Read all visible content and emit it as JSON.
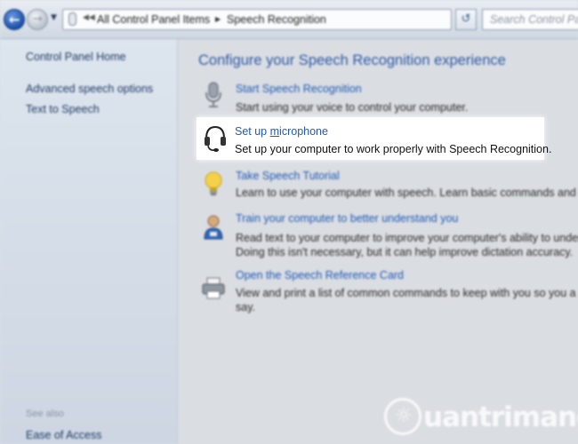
{
  "toolbar": {
    "breadcrumbs": [
      "All Control Panel Items",
      "Speech Recognition"
    ],
    "search_placeholder": "Search Control Pan"
  },
  "sidebar": {
    "home": "Control Panel Home",
    "links": [
      "Advanced speech options",
      "Text to Speech"
    ],
    "see_also_label": "See also",
    "see_also_links": [
      "Ease of Access"
    ]
  },
  "main": {
    "title": "Configure your Speech Recognition experience",
    "tasks": [
      {
        "icon": "microphone-icon",
        "link": "Start Speech Recognition",
        "desc": [
          "Start using your voice to control your computer."
        ]
      },
      {
        "icon": "headset-icon",
        "link_prefix": "Set up ",
        "link_accel": "m",
        "link_suffix": "icrophone",
        "desc": [
          "Set up your computer to work properly with Speech Recognition."
        ]
      },
      {
        "icon": "lightbulb-icon",
        "link": "Take Speech Tutorial",
        "desc": [
          "Learn to use your computer with speech.  Learn basic commands and dic"
        ]
      },
      {
        "icon": "person-icon",
        "link": "Train your computer to better understand you",
        "desc": [
          "Read text to your computer to improve your computer's ability to unders",
          "Doing this isn't necessary, but it can help improve dictation accuracy."
        ]
      },
      {
        "icon": "printer-icon",
        "link": "Open the Speech Reference Card",
        "desc": [
          "View and print a list of common commands to keep with you so you a",
          "say."
        ]
      }
    ]
  },
  "watermark": {
    "text": "uantrimang"
  },
  "colors": {
    "link": "#1f5bb5",
    "title": "#2c59a6",
    "highlight_bg": "#ffffff"
  }
}
